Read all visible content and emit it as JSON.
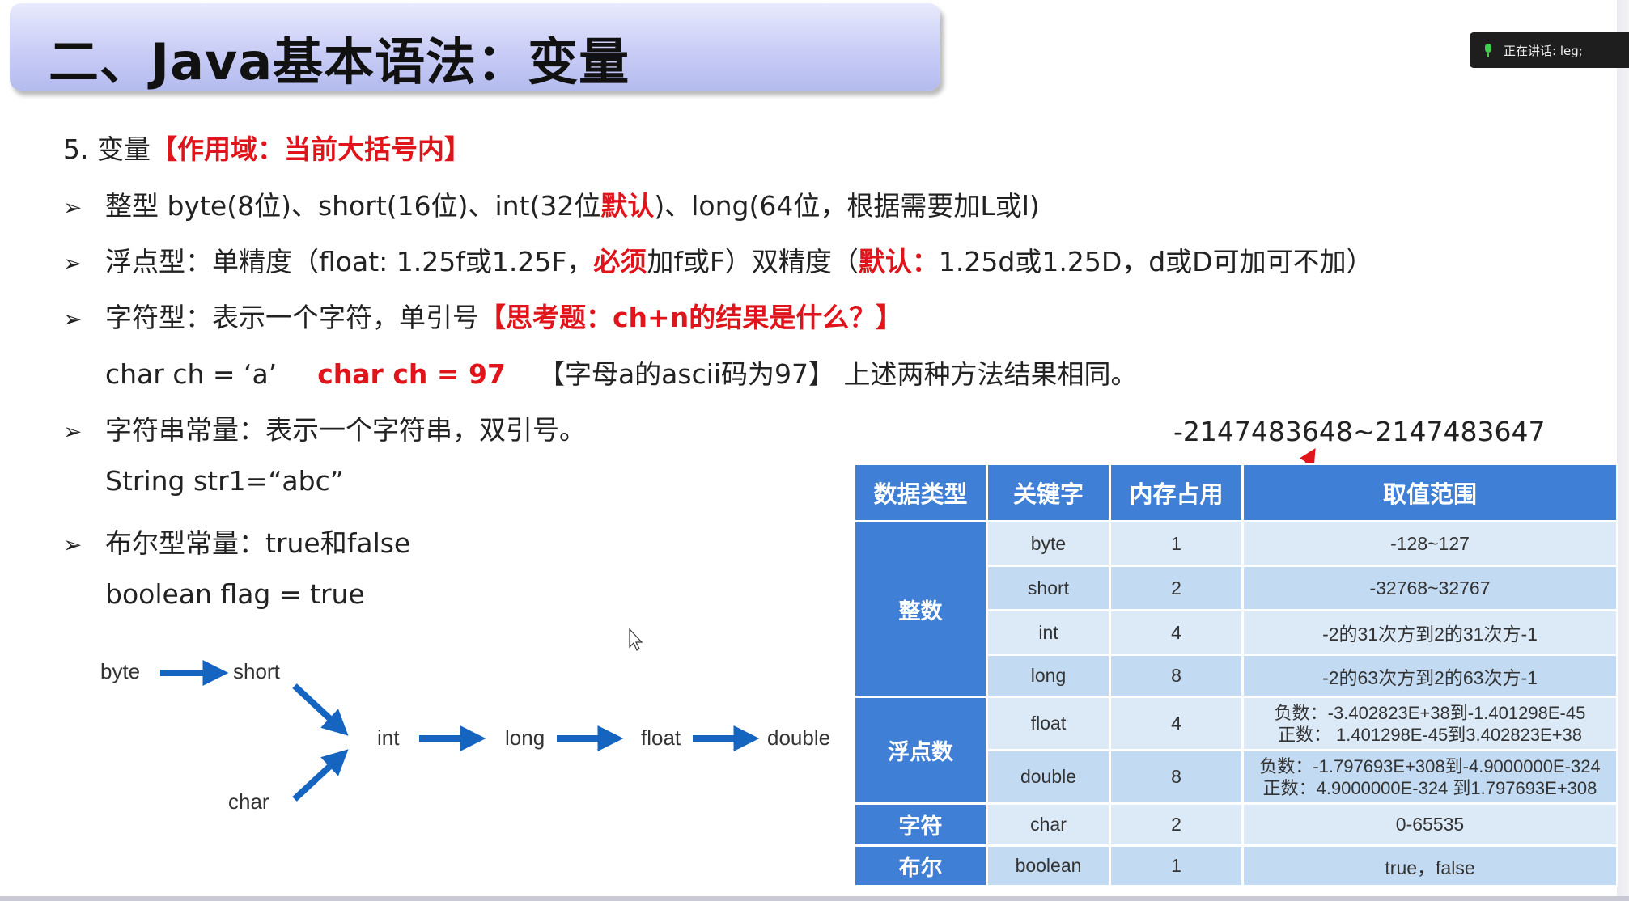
{
  "title": "二、Java基本语法：变量",
  "speaking_indicator": "正在讲话: leg;",
  "section": {
    "prefix": "5. 变量",
    "scope_note": "【作用域：当前大括号内】"
  },
  "lines": {
    "integer": {
      "part1": "整型  byte(8位)、short(16位)、int(32位",
      "red": "默认",
      "part2": ")、long(64位，根据需要加L或l)"
    },
    "float": {
      "part1": "浮点型：单精度（float: 1.25f或1.25F，",
      "red1": "必须",
      "part2": "加f或F）双精度（",
      "red2": "默认：",
      "part3": "1.25d或1.25D，d或D可加可不加）"
    },
    "char": {
      "part1": "字符型：表示一个字符，单引号",
      "red": "【思考题：ch+n的结果是什么？】"
    },
    "char_example": {
      "part1": "char ch = ‘a’",
      "red": "char ch = 97",
      "part2": "【字母a的ascii码为97】  上述两种方法结果相同。"
    },
    "string": {
      "text": "字符串常量：表示一个字符串，双引号。"
    },
    "string_example": {
      "text": "String str1=“abc”"
    },
    "boolean": {
      "text": "布尔型常量：true和false"
    },
    "boolean_example": {
      "text": "boolean flag = true"
    }
  },
  "conversion": {
    "byte": "byte",
    "short": "short",
    "char": "char",
    "int": "int",
    "long": "long",
    "float": "float",
    "double": "double",
    "arrow_color": "#1565c0"
  },
  "int_range_note": "-2147483648~2147483647",
  "table": {
    "headers": [
      "数据类型",
      "关键字",
      "内存占用",
      "取值范围"
    ],
    "categories": [
      "整数",
      "浮点数",
      "字符",
      "布尔"
    ],
    "rows": [
      {
        "keyword": "byte",
        "size": "1",
        "range": "-128~127"
      },
      {
        "keyword": "short",
        "size": "2",
        "range": "-32768~32767"
      },
      {
        "keyword": "int",
        "size": "4",
        "range": "-2的31次方到2的31次方-1"
      },
      {
        "keyword": "long",
        "size": "8",
        "range": "-2的63次方到2的63次方-1"
      },
      {
        "keyword": "float",
        "size": "4",
        "range_neg": "负数：-3.402823E+38到-1.401298E-45",
        "range_pos": "正数： 1.401298E-45到3.402823E+38"
      },
      {
        "keyword": "double",
        "size": "8",
        "range_neg": "负数：-1.797693E+308到-4.9000000E-324",
        "range_pos": "正数：4.9000000E-324 到1.797693E+308"
      },
      {
        "keyword": "char",
        "size": "2",
        "range": "0-65535"
      },
      {
        "keyword": "boolean",
        "size": "1",
        "range": "true，false"
      }
    ],
    "header_color": "#3f7fd6",
    "row_dark": "#c2daf2",
    "row_light": "#dceaf8"
  },
  "annotation_color": "#e0141b"
}
